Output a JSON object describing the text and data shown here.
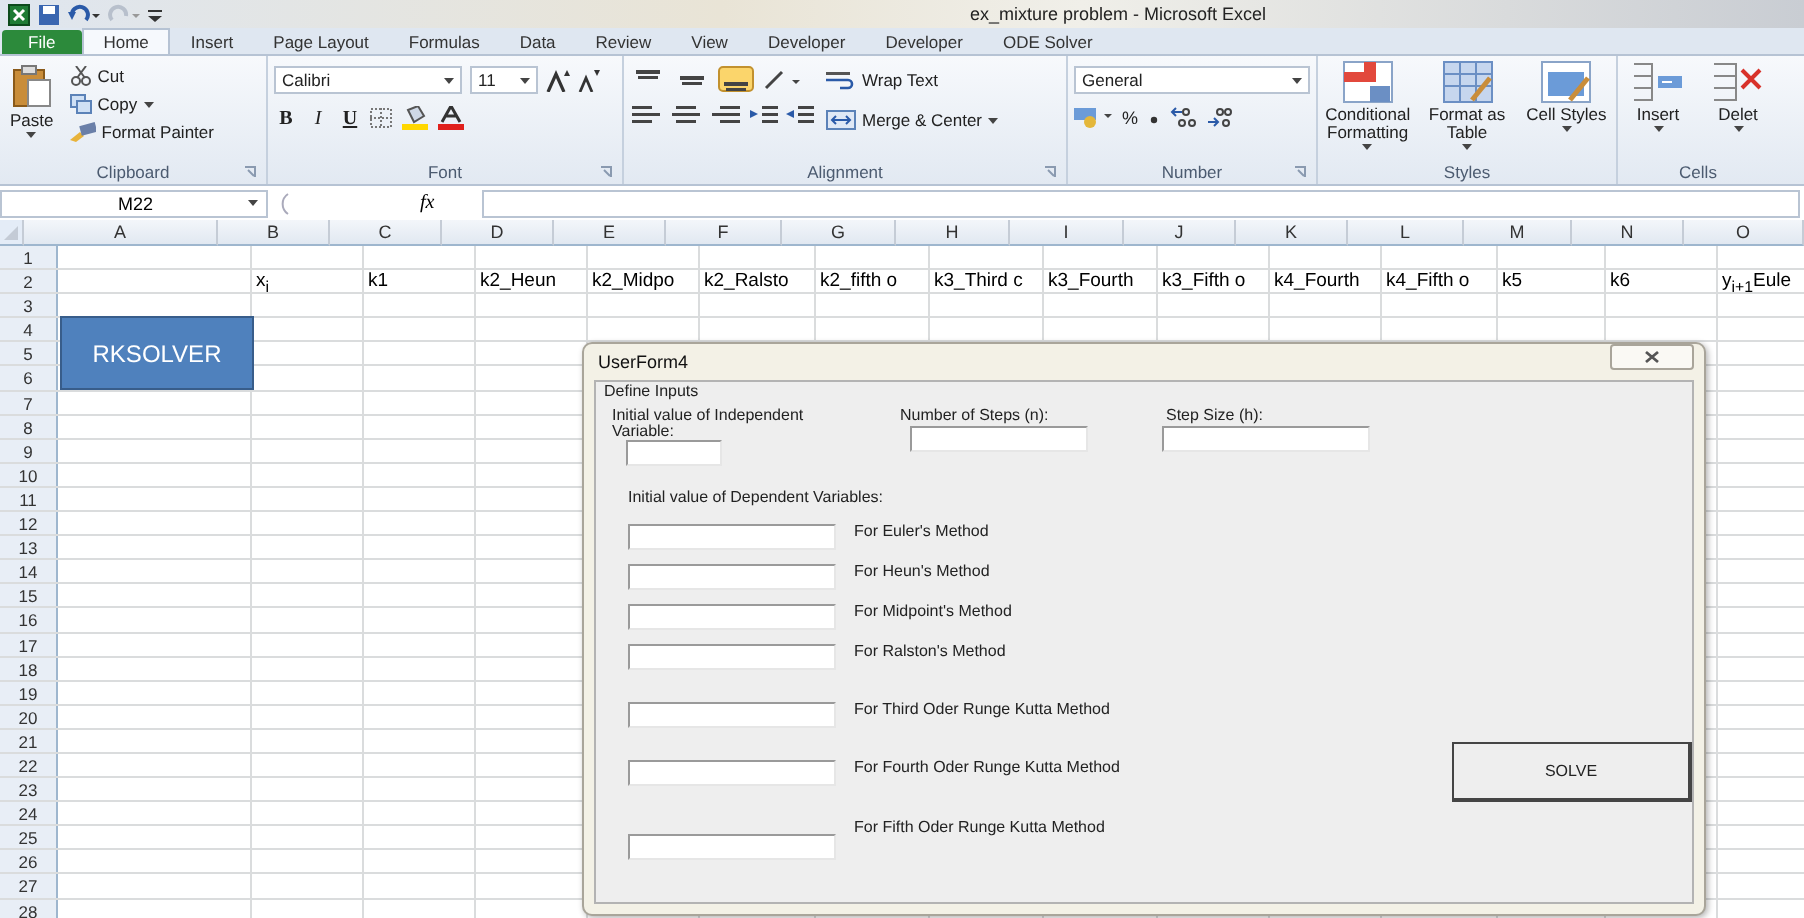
{
  "window": {
    "title": "ex_mixture problem  -  Microsoft Excel"
  },
  "tabs": [
    {
      "label": "File",
      "selected": false,
      "kind": "file"
    },
    {
      "label": "Home",
      "selected": true,
      "kind": "tab"
    },
    {
      "label": "Insert",
      "selected": false,
      "kind": "tab"
    },
    {
      "label": "Page Layout",
      "selected": false,
      "kind": "tab"
    },
    {
      "label": "Formulas",
      "selected": false,
      "kind": "tab"
    },
    {
      "label": "Data",
      "selected": false,
      "kind": "tab"
    },
    {
      "label": "Review",
      "selected": false,
      "kind": "tab"
    },
    {
      "label": "View",
      "selected": false,
      "kind": "tab"
    },
    {
      "label": "Developer",
      "selected": false,
      "kind": "tab"
    },
    {
      "label": "Developer",
      "selected": false,
      "kind": "tab"
    },
    {
      "label": "ODE Solver",
      "selected": false,
      "kind": "tab"
    }
  ],
  "ribbon": [
    {
      "kind": "clipboard",
      "label": "Clipboard",
      "paste": "Paste",
      "commands": [
        "Cut",
        "Copy",
        "Format Painter"
      ]
    },
    {
      "kind": "font",
      "label": "Font",
      "font_name": "Calibri",
      "font_size": "11",
      "styles": [
        "B",
        "I",
        "U"
      ]
    },
    {
      "kind": "alignment",
      "label": "Alignment",
      "valign": [
        {
          "selected": false
        },
        {
          "selected": false
        },
        {
          "selected": true
        }
      ],
      "commands": [
        "Wrap Text",
        "Merge & Center"
      ]
    },
    {
      "kind": "number",
      "label": "Number",
      "format": "General",
      "percent": "%"
    },
    {
      "kind": "styles",
      "label": "Styles",
      "commands": [
        "Conditional Formatting",
        "Format as Table",
        "Cell Styles"
      ]
    },
    {
      "kind": "cells",
      "label": "Cells",
      "commands": [
        "Insert",
        "Delet"
      ]
    }
  ],
  "formula_bar": {
    "name_box": "M22",
    "function_label": "fx"
  },
  "sheet": {
    "columns": [
      "A",
      "B",
      "C",
      "D",
      "E",
      "F",
      "G",
      "H",
      "I",
      "J",
      "K",
      "L",
      "M",
      "N",
      "O"
    ],
    "rows": [
      "1",
      "2",
      "3",
      "4",
      "5",
      "6",
      "7",
      "8",
      "9",
      "10",
      "11",
      "12",
      "13",
      "14",
      "15",
      "16",
      "17",
      "18",
      "19",
      "20",
      "21",
      "22",
      "23",
      "24",
      "25",
      "26",
      "27",
      "28"
    ],
    "row_2": [
      "x$_{i}$",
      "k1",
      "k2_Heun",
      "k2_Midpo",
      "k2_Ralsto",
      "k2_fifth o",
      "k3_Third c",
      "k3_Fourth",
      "k3_Fifth o",
      "k4_Fourth",
      "k4_Fifth o",
      "k5",
      "k6",
      "y$_{i+1}$Eule"
    ],
    "shape": {
      "label": "RKSOLVER"
    }
  },
  "userform": {
    "title": "UserForm4",
    "frame_label": "Define Inputs",
    "top_fields": [
      {
        "label": "Initial value of Independent Variable:"
      },
      {
        "label": "Number of Steps (n):"
      },
      {
        "label": "Step Size (h):"
      }
    ],
    "dependent_label": "Initial value of Dependent Variables:",
    "methods": [
      "For Euler's Method",
      "For Heun's Method",
      "For Midpoint's Method",
      "For Ralston's Method",
      "For Third Oder Runge Kutta Method",
      "For Fourth Oder Runge Kutta Method",
      "For Fifth Oder Runge Kutta Method"
    ],
    "button": "SOLVE"
  }
}
